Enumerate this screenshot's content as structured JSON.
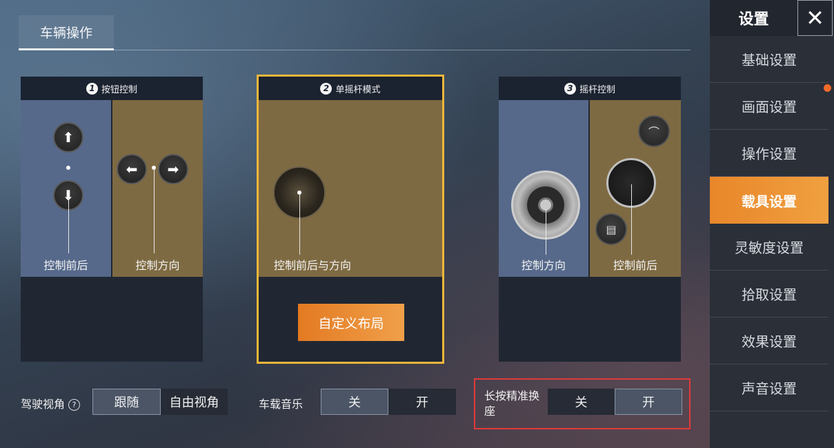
{
  "top_tab": "车辆操作",
  "panels": [
    {
      "num": "1",
      "title": "按钮控制",
      "left_label": "控制前后",
      "right_label": "控制方向"
    },
    {
      "num": "2",
      "title": "单摇杆模式",
      "label": "控制前后与方向",
      "custom_button": "自定义布局"
    },
    {
      "num": "3",
      "title": "摇杆控制",
      "left_label": "控制方向",
      "right_label": "控制前后"
    }
  ],
  "bottom": {
    "drive_view": {
      "label": "驾驶视角",
      "help": "?",
      "options": [
        "跟随",
        "自由视角"
      ],
      "selected": "跟随"
    },
    "car_music": {
      "label": "车载音乐",
      "options": [
        "关",
        "开"
      ],
      "selected": "关"
    },
    "long_press": {
      "label": "长按精准换座",
      "options": [
        "关",
        "开"
      ],
      "selected": "开"
    }
  },
  "sidebar": {
    "title": "设置",
    "close": "✕",
    "items": [
      "基础设置",
      "画面设置",
      "操作设置",
      "载具设置",
      "灵敏度设置",
      "拾取设置",
      "效果设置",
      "声音设置"
    ],
    "active": "载具设置"
  }
}
